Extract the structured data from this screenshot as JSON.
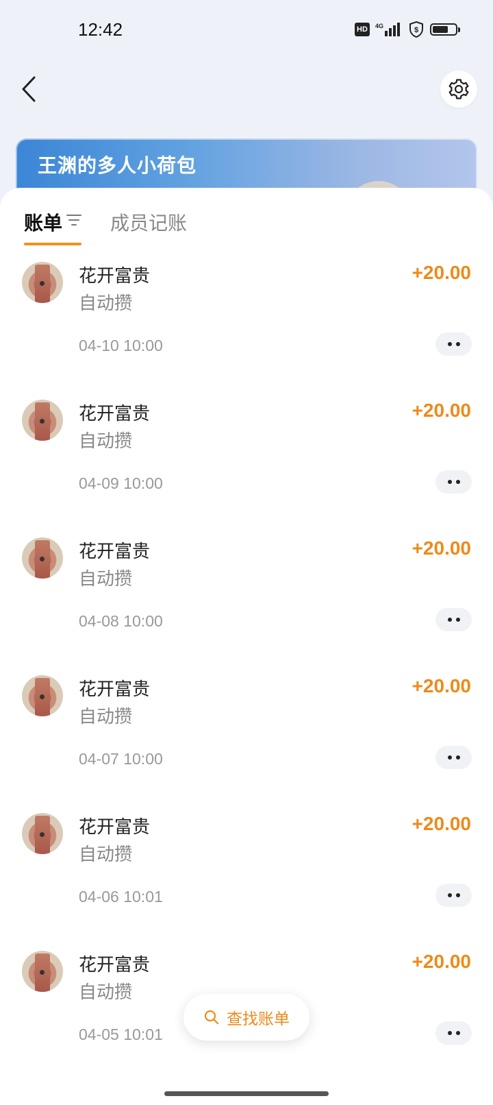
{
  "status_bar": {
    "time": "12:42",
    "hd": "HD",
    "network": "4G"
  },
  "wallet": {
    "title": "王渊的多人小荷包"
  },
  "tabs": [
    {
      "label": "账单",
      "active": true
    },
    {
      "label": "成员记账",
      "active": false
    }
  ],
  "bills": [
    {
      "name": "花开富贵",
      "desc": "自动攒",
      "amount": "+20.00",
      "date": "04-10 10:00"
    },
    {
      "name": "花开富贵",
      "desc": "自动攒",
      "amount": "+20.00",
      "date": "04-09 10:00"
    },
    {
      "name": "花开富贵",
      "desc": "自动攒",
      "amount": "+20.00",
      "date": "04-08 10:00"
    },
    {
      "name": "花开富贵",
      "desc": "自动攒",
      "amount": "+20.00",
      "date": "04-07 10:00"
    },
    {
      "name": "花开富贵",
      "desc": "自动攒",
      "amount": "+20.00",
      "date": "04-06 10:01"
    },
    {
      "name": "花开富贵",
      "desc": "自动攒",
      "amount": "+20.00",
      "date": "04-05 10:01"
    }
  ],
  "search": {
    "label": "查找账单"
  },
  "colors": {
    "accent": "#ee8a1a",
    "card_start": "#3b86d6",
    "card_end": "#b3c6ec"
  },
  "icons": {
    "back": "back-arrow-icon",
    "settings": "gear-icon",
    "filter": "filter-icon",
    "more": "more-dots-icon",
    "search": "search-icon"
  }
}
